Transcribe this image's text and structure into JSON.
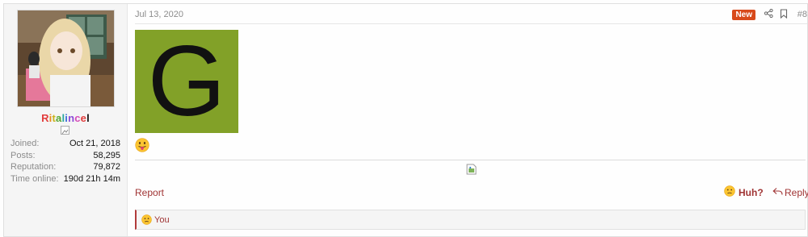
{
  "user": {
    "username_letters": [
      "R",
      "i",
      "t",
      "a",
      "l",
      "i",
      "n",
      "c",
      "e",
      "l"
    ],
    "stats": [
      {
        "key": "Joined:",
        "value": "Oct 21, 2018"
      },
      {
        "key": "Posts:",
        "value": "58,295"
      },
      {
        "key": "Reputation:",
        "value": "79,872"
      },
      {
        "key": "Time online:",
        "value": "190d 21h 14m"
      }
    ]
  },
  "post": {
    "date": "Jul 13, 2020",
    "new_badge": "New",
    "number": "#8",
    "image_letter": "G",
    "image_bg": "#82a128"
  },
  "actions": {
    "report": "Report",
    "reaction_label": "Huh?",
    "reply": "Reply"
  },
  "reactions_bar": {
    "who": "You"
  },
  "colors": {
    "accent": "#a03434",
    "badge": "#d84a1b"
  },
  "icons": [
    "share-icon",
    "bookmark-icon",
    "tongue-emoji-icon",
    "huh-emoji-icon",
    "reply-icon",
    "broken-image-icon"
  ]
}
